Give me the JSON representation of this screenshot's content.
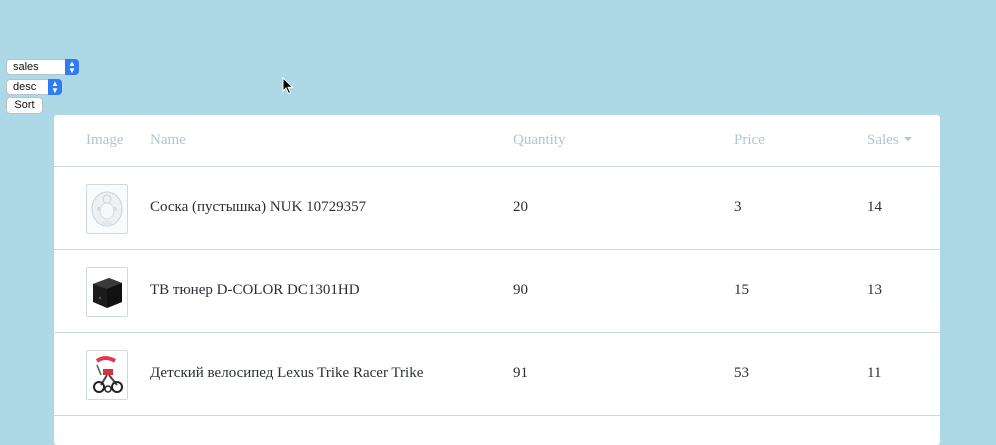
{
  "controls": {
    "sort_by": {
      "selected": "sales"
    },
    "order": {
      "selected": "desc"
    },
    "sort_button_label": "Sort"
  },
  "table": {
    "headers": {
      "image": "Image",
      "name": "Name",
      "quantity": "Quantity",
      "price": "Price",
      "sales": "Sales"
    },
    "sorted_column": "sales",
    "rows": [
      {
        "image_icon": "pacifier-photo",
        "name": "Соска (пустышка) NUK 10729357",
        "quantity": "20",
        "price": "3",
        "sales": "14"
      },
      {
        "image_icon": "tv-tuner-cube-photo",
        "name": "ТВ тюнер D-COLOR DC1301HD",
        "quantity": "90",
        "price": "15",
        "sales": "13"
      },
      {
        "image_icon": "kids-tricycle-photo",
        "name": "Детский велосипед Lexus Trike Racer Trike",
        "quantity": "91",
        "price": "53",
        "sales": "11"
      }
    ]
  },
  "colors": {
    "page_background": "#add8e6",
    "header_text": "#b5c3d0",
    "body_text": "#2b2f33",
    "divider": "#cfd8e0",
    "select_accent": "#2f7bf0"
  }
}
